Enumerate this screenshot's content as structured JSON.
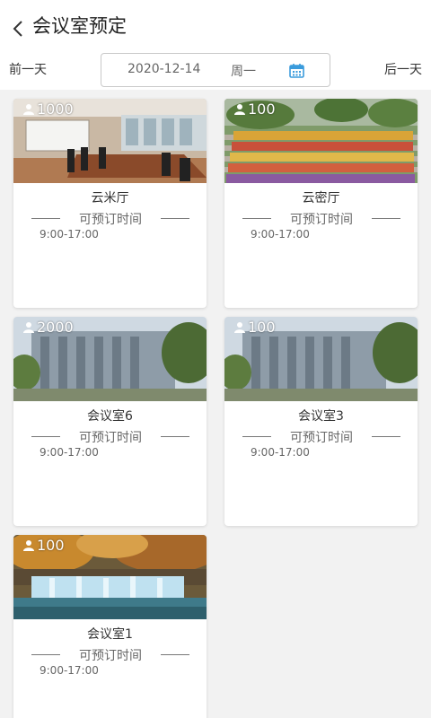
{
  "header": {
    "title": "会议室预定",
    "back_icon": "chevron-left-icon"
  },
  "date_nav": {
    "prev_label": "前一天",
    "next_label": "后一天",
    "date": "2020-12-14",
    "weekday": "周一",
    "calendar_icon": "calendar-icon"
  },
  "colors": {
    "accent": "#3a9bdc",
    "background": "#f2f2f2"
  },
  "rooms": [
    {
      "name": "云米厅",
      "capacity": "1000",
      "available_label": "可预订时间",
      "time_slot": "9:00-17:00",
      "image": "conference-room"
    },
    {
      "name": "云密厅",
      "capacity": "100",
      "available_label": "可预订时间",
      "time_slot": "9:00-17:00",
      "image": "group-photo"
    },
    {
      "name": "会议室6",
      "capacity": "2000",
      "available_label": "可预订时间",
      "time_slot": "9:00-17:00",
      "image": "building"
    },
    {
      "name": "会议室3",
      "capacity": "100",
      "available_label": "可预订时间",
      "time_slot": "9:00-17:00",
      "image": "building"
    },
    {
      "name": "会议室1",
      "capacity": "100",
      "available_label": "可预订时间",
      "time_slot": "9:00-17:00",
      "image": "waterfall"
    }
  ]
}
